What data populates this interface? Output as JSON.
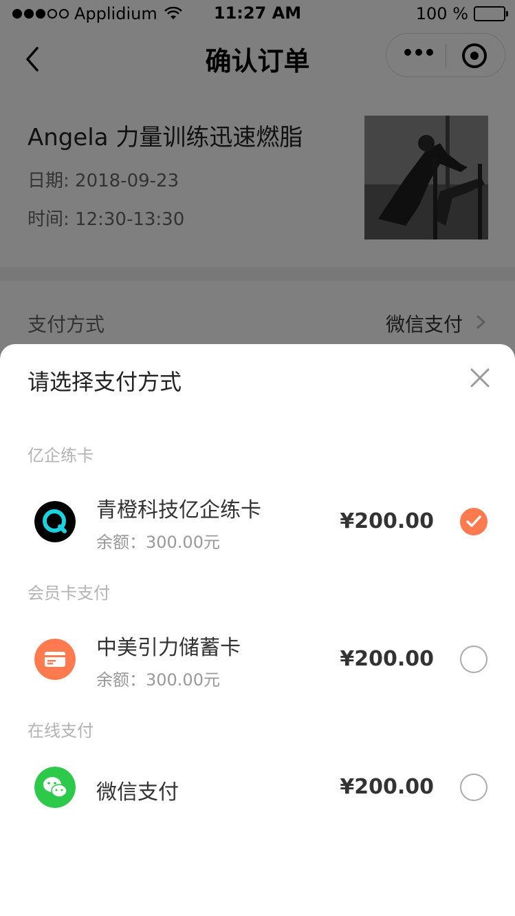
{
  "status_bar": {
    "carrier": "Applidium",
    "time": "11:27 AM",
    "battery": "100 %"
  },
  "nav": {
    "title": "确认订单"
  },
  "course": {
    "title": "Angela 力量训练迅速燃脂",
    "date": "日期: 2018-09-23",
    "time": "时间: 12:30-13:30"
  },
  "payment_row": {
    "label": "支付方式",
    "value": "微信支付"
  },
  "sheet": {
    "title": "请选择支付方式",
    "sections": [
      {
        "label": "亿企练卡",
        "option": {
          "name": "青橙科技亿企练卡",
          "balance": "余额：300.00元",
          "amount": "¥200.00",
          "selected": true,
          "icon": "qingcheng-logo-icon"
        }
      },
      {
        "label": "会员卡支付",
        "option": {
          "name": "中美引力储蓄卡",
          "balance": "余额：300.00元",
          "amount": "¥200.00",
          "selected": false,
          "icon": "card-icon"
        }
      },
      {
        "label": "在线支付",
        "option": {
          "name": "微信支付",
          "amount": "¥200.00",
          "selected": false,
          "icon": "wechat-icon"
        }
      }
    ]
  },
  "colors": {
    "accent": "#ff7a4f",
    "wechat_green": "#2dc94a",
    "card_orange": "#ff7a4f"
  }
}
